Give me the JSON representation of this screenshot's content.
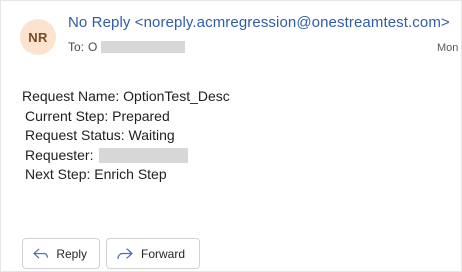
{
  "header": {
    "avatar_initials": "NR",
    "sender": "No Reply <noreply.acmregression@onestreamtest.com>",
    "to_label": "To:",
    "to_initial": "O",
    "date_partial": "Mon"
  },
  "body": {
    "request_name": "Request Name: OptionTest_Desc",
    "current_step": "Current Step: Prepared",
    "request_status": "Request Status: Waiting",
    "requester_label": "Requester:",
    "next_step": "Next Step: Enrich Step"
  },
  "actions": {
    "reply_label": "Reply",
    "forward_label": "Forward"
  },
  "colors": {
    "sender_link": "#2f5da8",
    "avatar_bg": "#fbe3cf",
    "avatar_text": "#7a4a24",
    "redaction": "#d7d7d7"
  },
  "icons": {
    "reply": "reply-arrow-icon",
    "forward": "forward-arrow-icon"
  }
}
